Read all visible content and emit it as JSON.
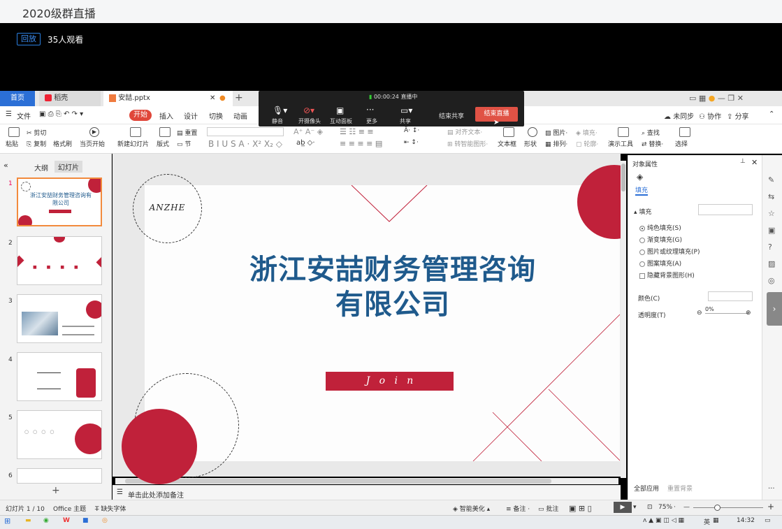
{
  "window": {
    "title": "2020级群直播"
  },
  "live": {
    "badge": "回放",
    "viewers": "35人观看",
    "timer": "00:00:24",
    "status": "直播中",
    "controls": [
      "静音",
      "开摄像头",
      "互动面板",
      "更多",
      "共享"
    ],
    "end_share": "结束共享",
    "end_live": "结束直播"
  },
  "tabs": {
    "home": "首页",
    "app": "稻壳",
    "file": "安喆.pptx"
  },
  "titlebar_right": {
    "sync": "未同步",
    "collab": "协作",
    "share": "分享"
  },
  "menu": [
    "文件",
    "开始",
    "插入",
    "设计",
    "切换",
    "动画"
  ],
  "ribbon": {
    "paste": "粘贴",
    "cut": "剪切",
    "copy": "复制",
    "format_painter": "格式刷",
    "play_from": "当页开始",
    "new_slide": "新建幻灯片",
    "layout": "版式",
    "section": "节",
    "reset": "重置",
    "align_text": "对齐文本",
    "smartart": "转智能图形",
    "textbox": "文本框",
    "shape": "形状",
    "arrange": "排列",
    "picture": "图片",
    "fill": "填充",
    "outline": "轮廓",
    "presenter": "演示工具",
    "find": "查找",
    "replace": "替换",
    "select": "选择"
  },
  "leftpane": {
    "tab_outline": "大纲",
    "tab_slides": "幻灯片",
    "slides": [
      "1",
      "2",
      "3",
      "4",
      "5",
      "6"
    ],
    "thumb1_title": "浙江安喆财务管理咨询有限公司"
  },
  "slide": {
    "logo": "ANZHE",
    "title_line1": "浙江安喆财务管理咨询",
    "title_line2": "有限公司",
    "join": "J   o   i   n",
    "colors": {
      "accent": "#c0213a",
      "title": "#1f5a8c"
    }
  },
  "rightpane": {
    "header": "对象属性",
    "tab": "填充",
    "section": "填充",
    "options": [
      "纯色填充(S)",
      "渐变填充(G)",
      "图片或纹理填充(P)",
      "图案填充(A)"
    ],
    "checkbox": "隐藏背景图形(H)",
    "color_label": "颜色(C)",
    "transparency_label": "透明度(T)",
    "transparency_value": "0%",
    "apply_all": "全部应用",
    "reset_bg": "重置背景"
  },
  "notes": {
    "placeholder": "单击此处添加备注"
  },
  "statusbar": {
    "slide_info": "幻灯片 1 / 10",
    "theme": "Office 主题",
    "missing_font": "缺失字体",
    "beautify": "智能美化",
    "notes": "备注",
    "comment": "批注",
    "zoom": "75%"
  },
  "taskbar": {
    "lang": "英",
    "time": "14:32"
  }
}
